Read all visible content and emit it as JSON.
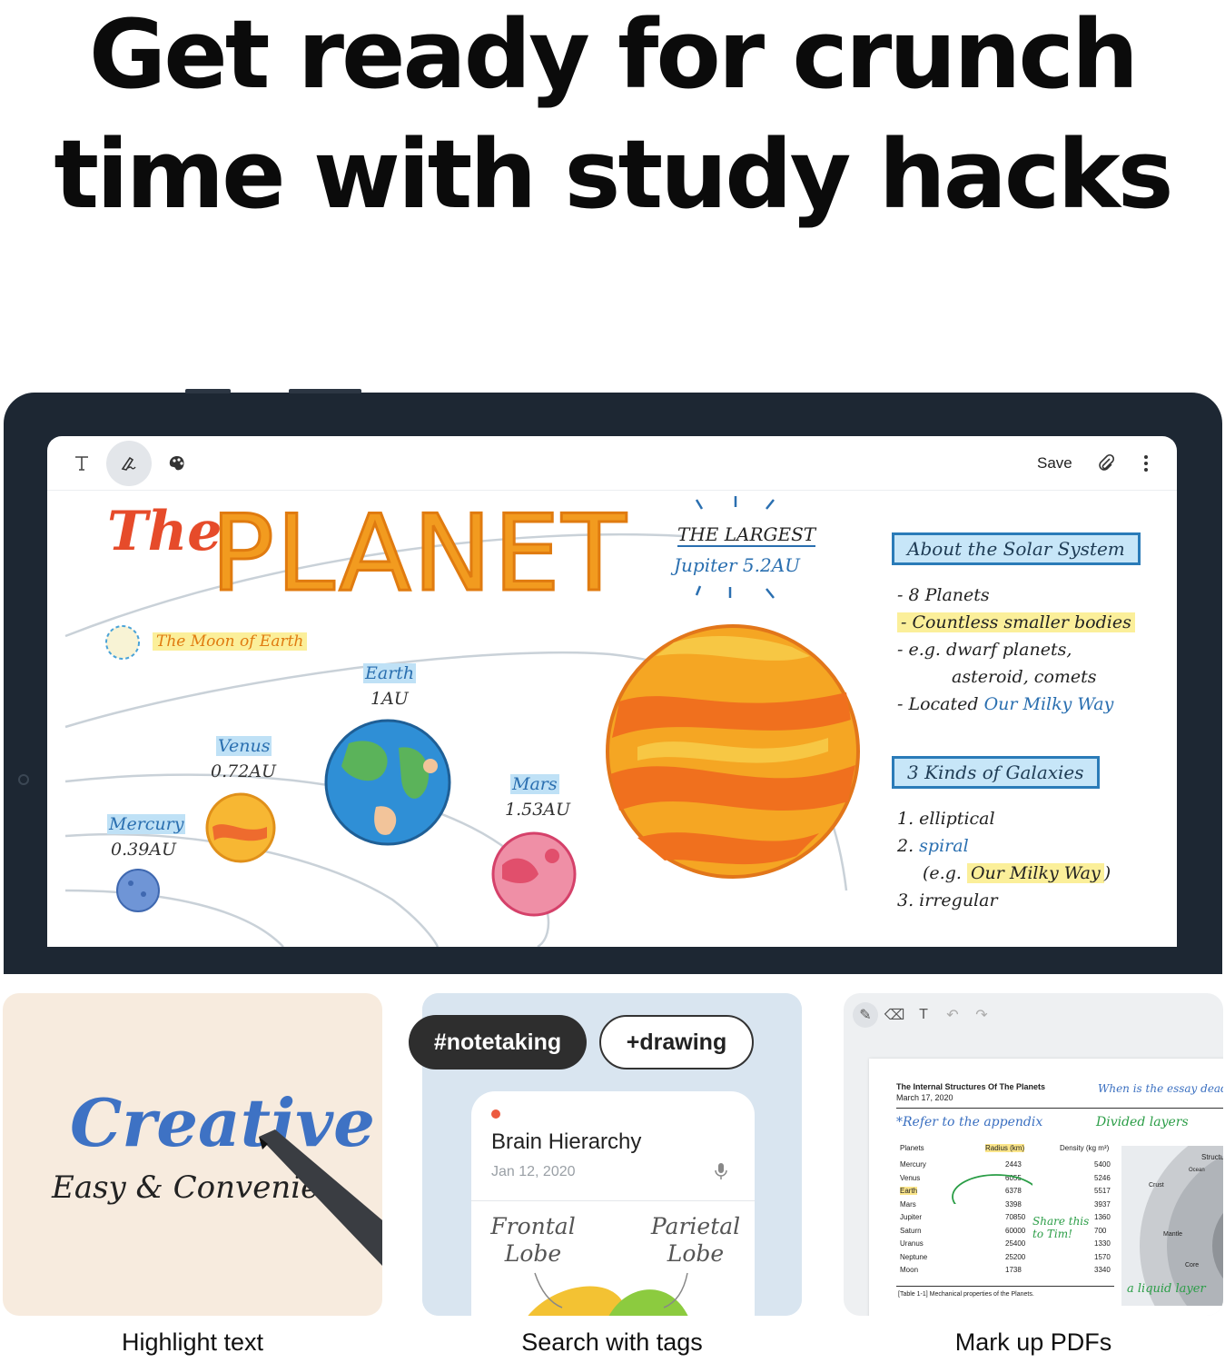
{
  "headline": {
    "line1": "Get ready for crunch",
    "line2": "time with study hacks"
  },
  "toolbar": {
    "save_label": "Save",
    "icons": [
      "text-icon",
      "pen-icon",
      "palette-icon",
      "attach-icon",
      "more-icon"
    ]
  },
  "note": {
    "title_the": "The",
    "title_planet": "PLANET",
    "moon_label": "The Moon of Earth",
    "largest_label": "THE LARGEST",
    "largest_value": "Jupiter 5.2AU",
    "planets": [
      {
        "name": "Mercury",
        "au": "0.39AU"
      },
      {
        "name": "Venus",
        "au": "0.72AU"
      },
      {
        "name": "Earth",
        "au": "1AU"
      },
      {
        "name": "Mars",
        "au": "1.53AU"
      }
    ],
    "about_heading": "About the Solar System",
    "about_items": [
      "- 8 Planets",
      "- Countless smaller bodies",
      "- e.g. dwarf planets,",
      "asteroid, comets",
      "- Located ",
      "Our Milky Way"
    ],
    "galaxies_heading": "3 Kinds of Galaxies",
    "galaxies_items": [
      "1. elliptical",
      "2. ",
      "spiral",
      "(e.g. ",
      "Our Milky Way",
      ")",
      "3. irregular"
    ]
  },
  "cards": {
    "highlight": {
      "word_large": "Creative",
      "word_small": "Easy & Convenie",
      "caption": "Highlight text"
    },
    "tags": {
      "tag1": "#notetaking",
      "tag2": "+drawing",
      "note_title": "Brain Hierarchy",
      "note_date": "Jan 12, 2020",
      "lobe1": "Frontal Lobe",
      "lobe2": "Parietal Lobe",
      "caption": "Search with tags"
    },
    "pdf": {
      "doc_title": "The Internal Structures Of The Planets",
      "doc_date": "March 17, 2020",
      "note_top": "When is the essay dead",
      "note_refer": "*Refer to the appendix",
      "note_layers": "Divided layers",
      "note_share": "Share this to Tim!",
      "note_liquid": "a liquid layer",
      "columns": [
        "Planets",
        "Radius (km)",
        "Density (kg m³)"
      ],
      "rows": [
        [
          "Mercury",
          "2443",
          "5400"
        ],
        [
          "Venus",
          "6055",
          "5246"
        ],
        [
          "Earth",
          "6378",
          "5517"
        ],
        [
          "Mars",
          "3398",
          "3937"
        ],
        [
          "Jupiter",
          "70850",
          "1360"
        ],
        [
          "Saturn",
          "60000",
          "700"
        ],
        [
          "Uranus",
          "25400",
          "1330"
        ],
        [
          "Neptune",
          "25200",
          "1570"
        ],
        [
          "Moon",
          "1738",
          "3340"
        ]
      ],
      "table_caption": "[Table 1-1] Mechanical properties of the Planets.",
      "diagram_labels": [
        "Structure",
        "Crust",
        "Mantle",
        "Core",
        "Ocean"
      ],
      "caption": "Mark up PDFs"
    }
  },
  "colors": {
    "tablet_frame": "#1d2733",
    "highlight_yellow": "#fbef9a",
    "highlight_blue": "#bfe1f6",
    "title_orange": "#f29b1f",
    "title_red": "#e64b2a",
    "ink_blue": "#2a6fb0",
    "ink_green": "#2a9d46"
  }
}
